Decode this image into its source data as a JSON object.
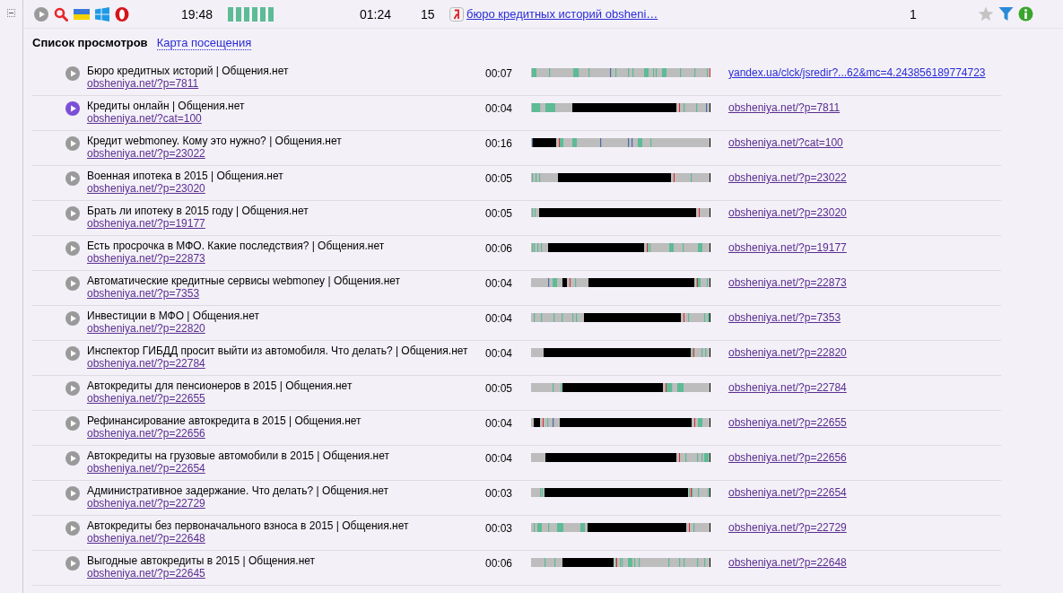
{
  "session": {
    "expanded": true,
    "time": "19:48",
    "activity": "01:24",
    "pages": "15",
    "source_link": "бюро кредитных историй obsheni…",
    "visits": "1"
  },
  "tabs": [
    {
      "label": "Список просмотров",
      "selected": true
    },
    {
      "label": "Карта посещения",
      "selected": false
    }
  ],
  "views": [
    {
      "title": "Бюро кредитных историй | Общения.нет",
      "url": "obsheniya.net/?p=7811",
      "duration": "00:07",
      "referrer": "yandex.ua/clck/jsredir?...62&mc=4.243856189774723",
      "playing": false
    },
    {
      "title": "Кредиты онлайн | Общения.нет",
      "url": "obsheniya.net/?cat=100",
      "duration": "00:04",
      "referrer": "obsheniya.net/?p=7811",
      "playing": true
    },
    {
      "title": "Кредит webmoney. Кому это нужно? | Общения.нет",
      "url": "obsheniya.net/?p=23022",
      "duration": "00:16",
      "referrer": "obsheniya.net/?cat=100",
      "playing": false
    },
    {
      "title": "Военная ипотека в 2015 | Общения.нет",
      "url": "obsheniya.net/?p=23020",
      "duration": "00:05",
      "referrer": "obsheniya.net/?p=23022",
      "playing": false
    },
    {
      "title": "Брать ли ипотеку в 2015 году | Общения.нет",
      "url": "obsheniya.net/?p=19177",
      "duration": "00:05",
      "referrer": "obsheniya.net/?p=23020",
      "playing": false
    },
    {
      "title": "Есть просрочка в МФО. Какие последствия? | Общения.нет",
      "url": "obsheniya.net/?p=22873",
      "duration": "00:06",
      "referrer": "obsheniya.net/?p=19177",
      "playing": false
    },
    {
      "title": "Автоматические кредитные сервисы webmoney | Общения.нет",
      "url": "obsheniya.net/?p=7353",
      "duration": "00:04",
      "referrer": "obsheniya.net/?p=22873",
      "playing": false
    },
    {
      "title": "Инвестиции в МФО | Общения.нет",
      "url": "obsheniya.net/?p=22820",
      "duration": "00:04",
      "referrer": "obsheniya.net/?p=7353",
      "playing": false
    },
    {
      "title": "Инспектор ГИБДД просит выйти из автомобиля. Что делать? | Общения.нет",
      "url": "obsheniya.net/?p=22784",
      "duration": "00:04",
      "referrer": "obsheniya.net/?p=22820",
      "playing": false
    },
    {
      "title": "Автокредиты для пенсионеров в 2015 | Общения.нет",
      "url": "obsheniya.net/?p=22655",
      "duration": "00:05",
      "referrer": "obsheniya.net/?p=22784",
      "playing": false
    },
    {
      "title": "Рефинансирование автокредита в 2015 | Общения.нет",
      "url": "obsheniya.net/?p=22656",
      "duration": "00:04",
      "referrer": "obsheniya.net/?p=22655",
      "playing": false
    },
    {
      "title": "Автокредиты на грузовые автомобили в 2015 | Общения.нет",
      "url": "obsheniya.net/?p=22654",
      "duration": "00:04",
      "referrer": "obsheniya.net/?p=22656",
      "playing": false
    },
    {
      "title": "Административное задержание. Что делать? | Общения.нет",
      "url": "obsheniya.net/?p=22729",
      "duration": "00:03",
      "referrer": "obsheniya.net/?p=22654",
      "playing": false
    },
    {
      "title": "Автокредиты без первоначального взноса в 2015 | Общения.нет",
      "url": "obsheniya.net/?p=22648",
      "duration": "00:03",
      "referrer": "obsheniya.net/?p=22729",
      "playing": false
    },
    {
      "title": "Выгодные автокредиты в 2015 | Общения.нет",
      "url": "obsheniya.net/?p=22645",
      "duration": "00:06",
      "referrer": "obsheniya.net/?p=22648",
      "playing": false
    }
  ]
}
